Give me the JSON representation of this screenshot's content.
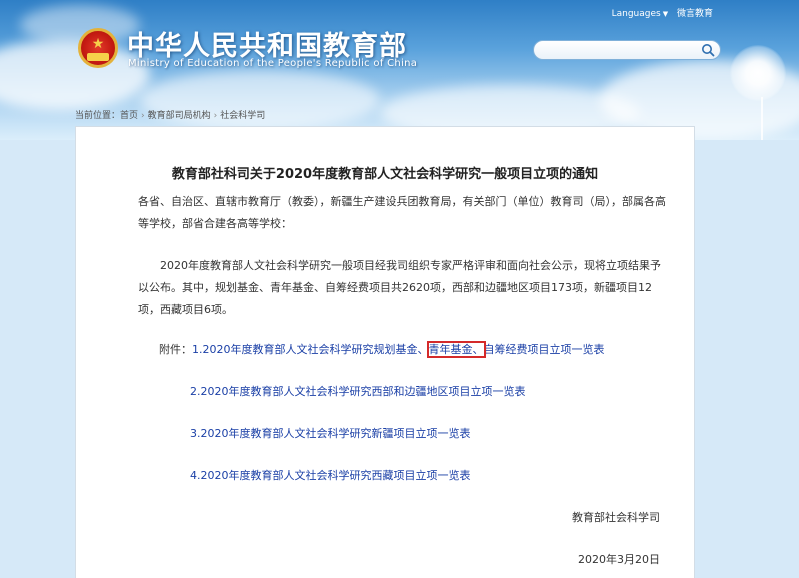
{
  "header": {
    "title": "中华人民共和国教育部",
    "subtitle": "Ministry of Education of the People's Republic of China",
    "languages": "Languages",
    "weibo": "微言教育",
    "search_placeholder": ""
  },
  "breadcrumb": {
    "prefix": "当前位置：",
    "items": [
      "首页",
      "教育部司局机构",
      "社会科学司"
    ]
  },
  "article": {
    "title": "教育部社科司关于2020年度教育部人文社会科学研究一般项目立项的通知",
    "para1": "各省、自治区、直辖市教育厅（教委），新疆生产建设兵团教育局，有关部门（单位）教育司（局），部属各高等学校，部省合建各高等学校：",
    "para2": "2020年度教育部人文社会科学研究一般项目经我司组织专家严格评审和面向社会公示，现将立项结果予以公布。其中，规划基金、青年基金、自筹经费项目共2620项，西部和边疆地区项目173项，新疆项目12项，西藏项目6项。",
    "attachment_label": "附件：",
    "attachments": [
      {
        "part1": "1.2020年度教育部人文社会科学研究规划基金、",
        "highlight": "青年基金、",
        "part2": "自筹经费项目立项一览表"
      },
      {
        "text": "2.2020年度教育部人文社会科学研究西部和边疆地区项目立项一览表"
      },
      {
        "text": "3.2020年度教育部人文社会科学研究新疆项目立项一览表"
      },
      {
        "text": "4.2020年度教育部人文社会科学研究西藏项目立项一览表"
      }
    ],
    "signature": "教育部社会科学司",
    "date": "2020年3月20日"
  },
  "colors": {
    "link": "#1a3fa6",
    "highlight_border": "#d42a2a",
    "sky": "#5aa2dc"
  }
}
